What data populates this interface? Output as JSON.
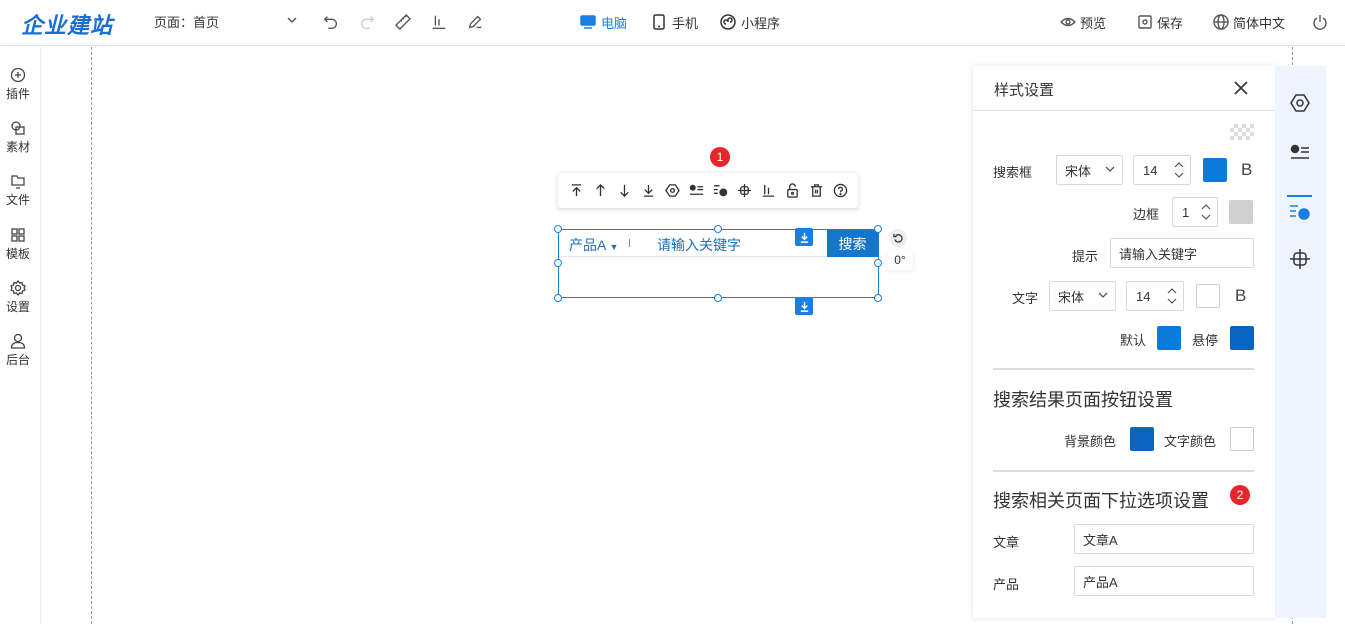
{
  "app": {
    "logo": "企业建站"
  },
  "header": {
    "page_label": "页面：",
    "page_value": "首页",
    "devices": [
      {
        "label": "电脑",
        "icon": "monitor-icon",
        "active": true
      },
      {
        "label": "手机",
        "icon": "phone-icon",
        "active": false
      },
      {
        "label": "小程序",
        "icon": "miniprogram-icon",
        "active": false
      }
    ],
    "actions": {
      "preview": "预览",
      "save": "保存",
      "language": "简体中文"
    }
  },
  "sidebar": {
    "items": [
      {
        "label": "插件",
        "icon": "plus-circle-icon"
      },
      {
        "label": "素材",
        "icon": "shapes-icon"
      },
      {
        "label": "文件",
        "icon": "folder-icon"
      },
      {
        "label": "模板",
        "icon": "grid-icon"
      },
      {
        "label": "设置",
        "icon": "gear-icon"
      },
      {
        "label": "后台",
        "icon": "user-icon"
      }
    ]
  },
  "canvas": {
    "badge_1": "1",
    "badge_2": "2",
    "search_widget": {
      "category": "产品A",
      "placeholder": "请输入关键字",
      "button": "搜索"
    },
    "rotation": "0°"
  },
  "style_panel": {
    "title": "样式设置",
    "search_box": {
      "label": "搜索框",
      "font": "宋体",
      "size": "14",
      "color": "#0a7ad8",
      "bold_label": "B"
    },
    "border": {
      "label": "边框",
      "value": "1",
      "color": "#cfcfcf"
    },
    "hint": {
      "label": "提示",
      "value": "请输入关键字"
    },
    "text": {
      "label": "文字",
      "font": "宋体",
      "size": "14",
      "color": "#ffffff",
      "bold_label": "B"
    },
    "state": {
      "default_label": "默认",
      "default_color": "#0a7ad8",
      "hover_label": "悬停",
      "hover_color": "#0b64c0"
    },
    "result_section": {
      "title": "搜索结果页面按钮设置",
      "bg_label": "背景颜色",
      "bg_color": "#0b64c0",
      "text_label": "文字颜色",
      "text_color": "#ffffff"
    },
    "dropdown_section": {
      "title": "搜索相关页面下拉选项设置",
      "article_label": "文章",
      "article_value": "文章A",
      "product_label": "产品",
      "product_value": "产品A"
    }
  },
  "colors": {
    "accent": "#1a7fe0",
    "badge": "#e8262a",
    "rail_bg": "#eef4fd"
  }
}
